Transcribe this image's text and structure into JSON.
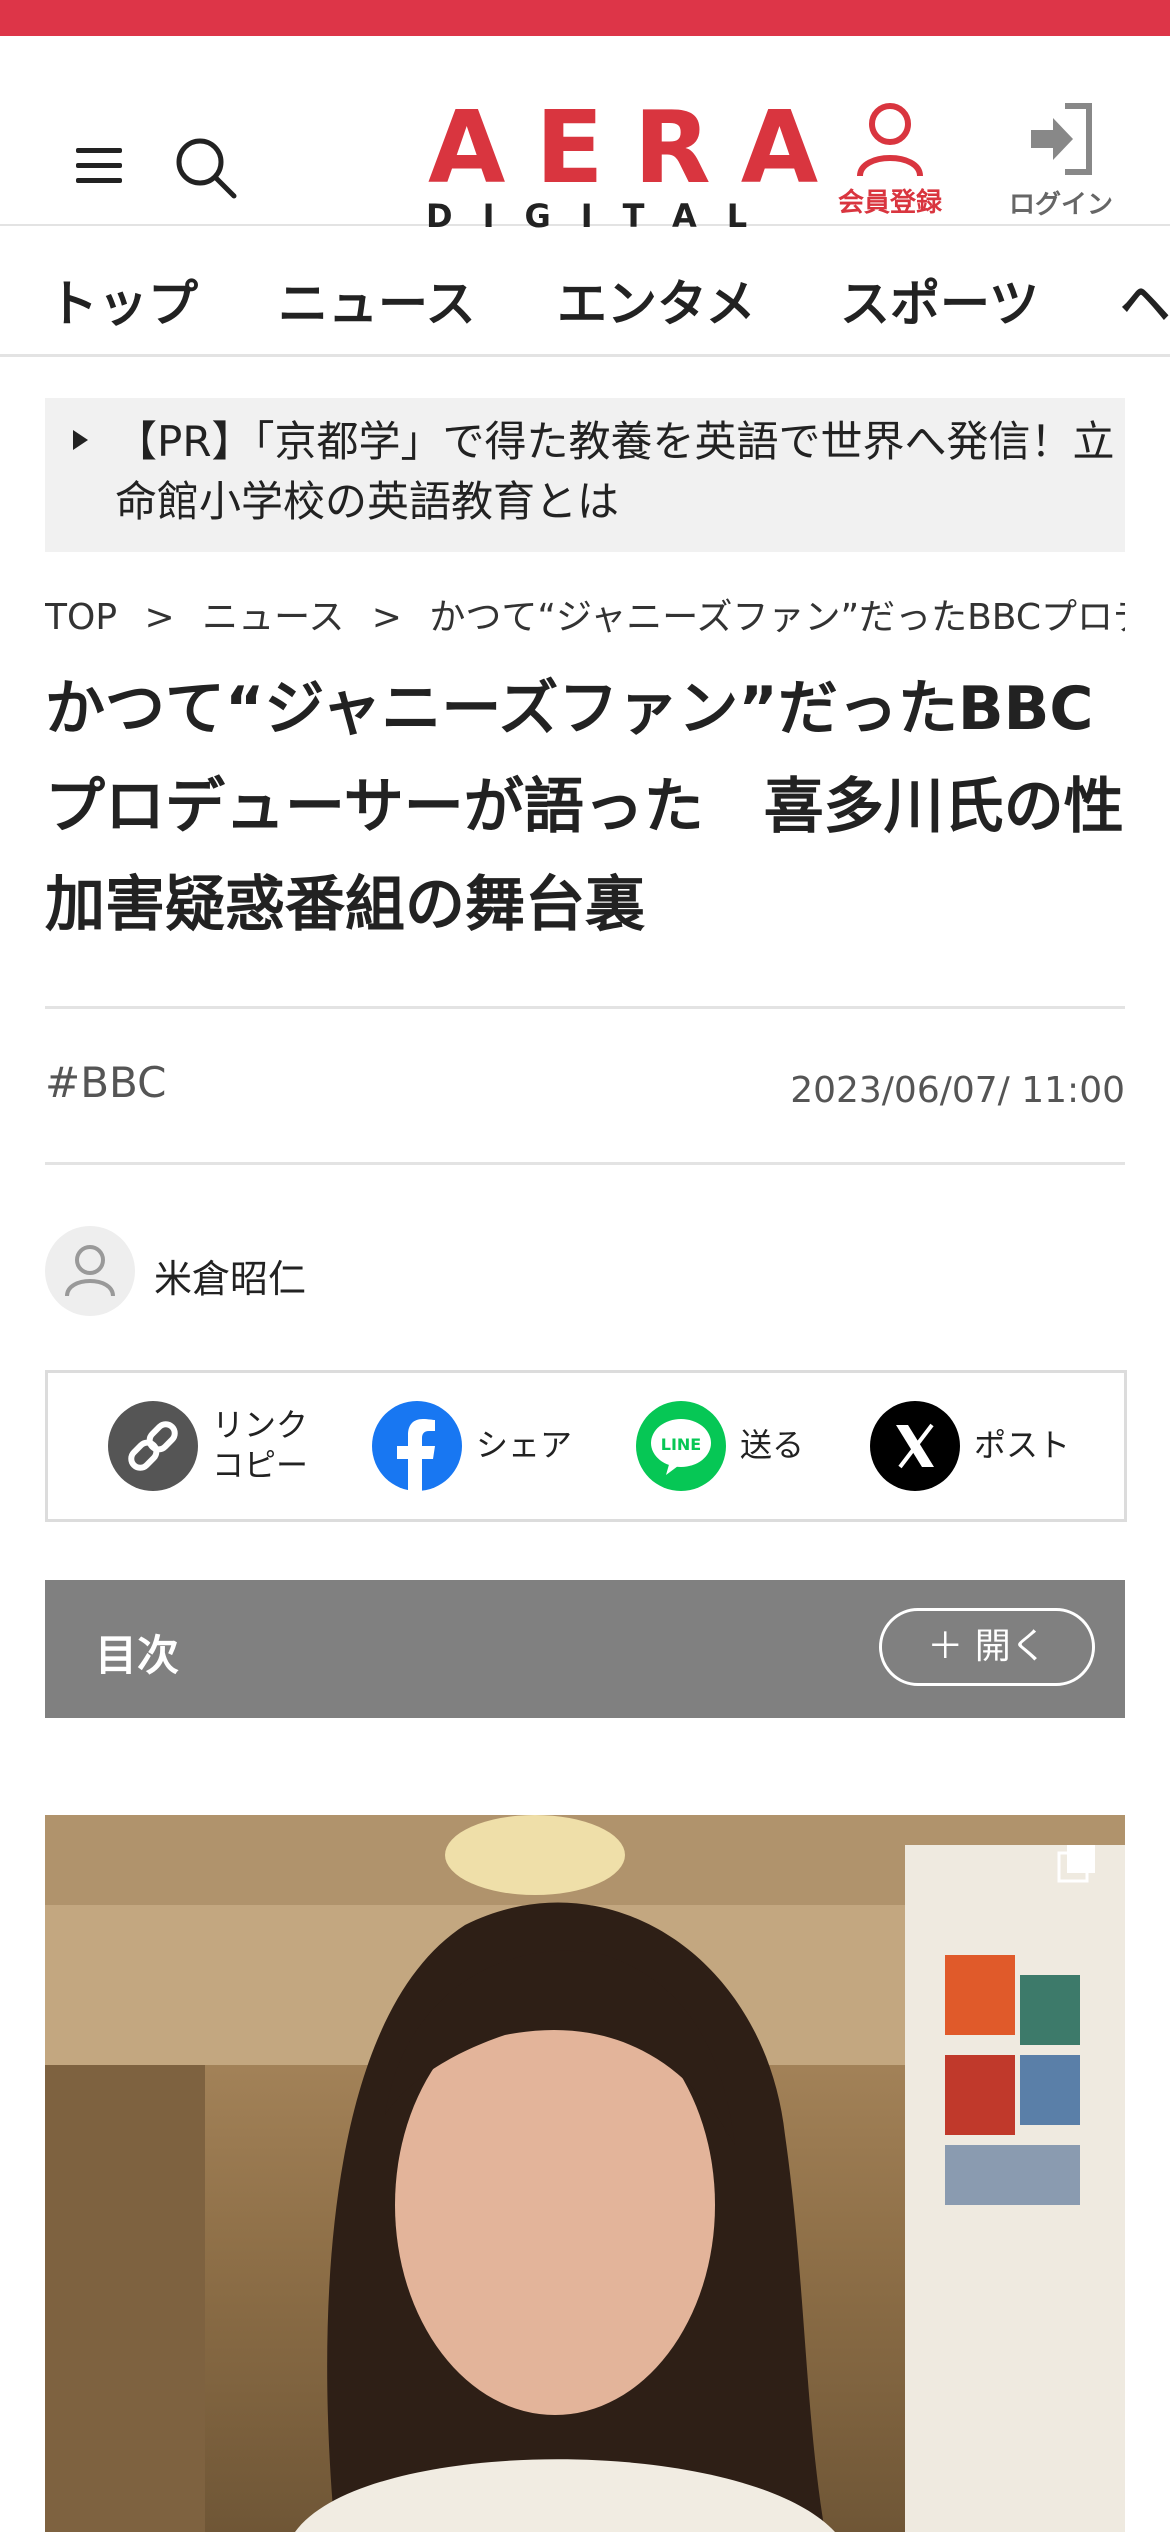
{
  "header": {
    "logo_main": "AERA",
    "logo_sub": "DIGITAL",
    "member_label": "会員登録",
    "login_label": "ログイン",
    "accent_color": "#dd3548"
  },
  "nav": {
    "items": [
      "トップ",
      "ニュース",
      "エンタメ",
      "スポーツ",
      "ヘ"
    ]
  },
  "pr": {
    "text": "【PR】「京都学」で得た教養を英語で世界へ発信！立命館小学校の英語教育とは"
  },
  "breadcrumb": {
    "items": [
      "TOP",
      ">",
      "ニュース",
      ">",
      "かつて“ジャニーズファン”だったBBCプロデュ"
    ]
  },
  "article": {
    "title": "かつて“ジャニーズファン”だったBBCプロデューサーが語った　喜多川氏の性加害疑惑番組の舞台裏",
    "tag": "#BBC",
    "date": "2023/06/07/ 11:00",
    "author": "米倉昭仁"
  },
  "share": {
    "items": [
      {
        "label_line1": "リンク",
        "label_line2": "コピー",
        "icon": "link-icon",
        "color": "#555555"
      },
      {
        "label": "シェア",
        "icon": "facebook-icon",
        "color": "#1877f2"
      },
      {
        "label": "送る",
        "icon": "line-icon",
        "color": "#06c755",
        "icon_text": "LINE"
      },
      {
        "label": "ポスト",
        "icon": "x-icon",
        "color": "#000000"
      }
    ]
  },
  "toc": {
    "title": "目次",
    "button_label": "＋ 開く"
  }
}
